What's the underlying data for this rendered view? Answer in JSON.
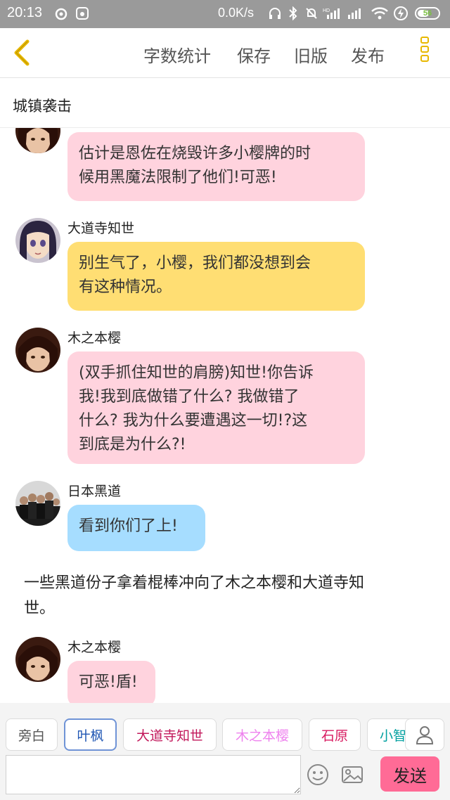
{
  "status_bar": {
    "time": "20:13",
    "net_speed": "0.0K/s",
    "battery": "56",
    "icons": [
      "weibo-icon",
      "baidu-icon",
      "headphones-icon",
      "bluetooth-icon",
      "mute-bell-icon",
      "hd-signal-icon",
      "signal-icon",
      "wifi-icon",
      "charging-icon",
      "battery-icon"
    ]
  },
  "toolbar": {
    "back_icon": "chevron-left-icon",
    "actions": [
      "字数统计",
      "保存",
      "旧版",
      "发布"
    ],
    "menu_icon": "more-vertical-icon",
    "accent_color": "#e8b800"
  },
  "chapter": {
    "title": "城镇袭击"
  },
  "messages": [
    {
      "speaker": "",
      "color": "#ffd3de",
      "text_lines": [
        "估计是恩佐在烧毁许多小樱牌的时",
        "候用黑魔法限制了他们!可恶!"
      ]
    },
    {
      "speaker": "大道寺知世",
      "color": "#ffde73",
      "text_lines": [
        "别生气了，小樱，我们都没想到会",
        "有这种情况。"
      ]
    },
    {
      "speaker": "木之本樱",
      "color": "#ffd3de",
      "text_lines": [
        "(双手抓住知世的肩膀)知世!你告诉",
        "我!我到底做错了什么? 我做错了",
        "什么? 我为什么要遭遇这一切!?这",
        "到底是为什么?!"
      ]
    },
    {
      "speaker": "日本黑道",
      "color": "#a6ddff",
      "text_lines": [
        "看到你们了上!"
      ]
    },
    {
      "narration_lines": [
        "一些黑道份子拿着棍棒冲向了木之本樱和大道寺知",
        "世。"
      ]
    },
    {
      "speaker": "木之本樱",
      "color": "#ffd3de",
      "text_lines": [
        "可恶!盾!"
      ]
    }
  ],
  "character_bar": {
    "chips": [
      {
        "label": "旁白",
        "color": "#555555"
      },
      {
        "label": "叶枫",
        "color": "#1e55b3",
        "selected": true
      },
      {
        "label": "大道寺知世",
        "color": "#c2185b"
      },
      {
        "label": "木之本樱",
        "color": "#ee82ee"
      },
      {
        "label": "石原",
        "color": "#d81b60"
      },
      {
        "label": "小智",
        "color": "#00a0a0"
      }
    ],
    "user_icon": "user-icon"
  },
  "input": {
    "placeholder": "",
    "emoji_icon": "emoji-icon",
    "image_icon": "image-icon",
    "send_label": "发送",
    "send_color": "#ff6b96"
  }
}
